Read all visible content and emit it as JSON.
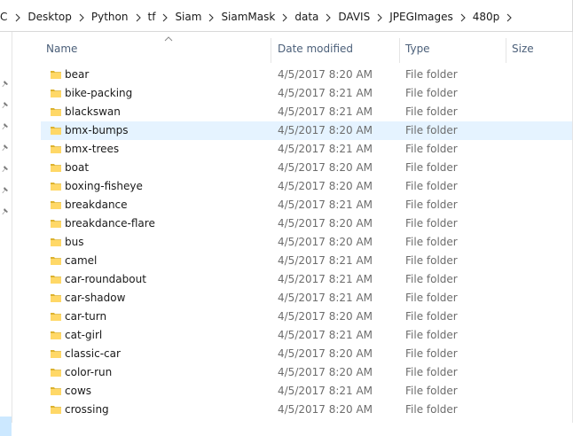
{
  "breadcrumb": {
    "items": [
      "C",
      "Desktop",
      "Python",
      "tf",
      "Siam",
      "SiamMask",
      "data",
      "DAVIS",
      "JPEGImages",
      "480p"
    ]
  },
  "columns": {
    "name": "Name",
    "date_modified": "Date modified",
    "type": "Type",
    "size": "Size"
  },
  "sort": {
    "column": "name",
    "direction": "ascending"
  },
  "colors": {
    "selected_row": "#e5f3ff",
    "folder": "#ffd867",
    "nav_selected": "#cce8ff"
  },
  "files": [
    {
      "name": "bear",
      "date": "4/5/2017 8:20 AM",
      "type": "File folder",
      "selected": false
    },
    {
      "name": "bike-packing",
      "date": "4/5/2017 8:21 AM",
      "type": "File folder",
      "selected": false
    },
    {
      "name": "blackswan",
      "date": "4/5/2017 8:21 AM",
      "type": "File folder",
      "selected": false
    },
    {
      "name": "bmx-bumps",
      "date": "4/5/2017 8:20 AM",
      "type": "File folder",
      "selected": true
    },
    {
      "name": "bmx-trees",
      "date": "4/5/2017 8:21 AM",
      "type": "File folder",
      "selected": false
    },
    {
      "name": "boat",
      "date": "4/5/2017 8:20 AM",
      "type": "File folder",
      "selected": false
    },
    {
      "name": "boxing-fisheye",
      "date": "4/5/2017 8:20 AM",
      "type": "File folder",
      "selected": false
    },
    {
      "name": "breakdance",
      "date": "4/5/2017 8:21 AM",
      "type": "File folder",
      "selected": false
    },
    {
      "name": "breakdance-flare",
      "date": "4/5/2017 8:20 AM",
      "type": "File folder",
      "selected": false
    },
    {
      "name": "bus",
      "date": "4/5/2017 8:20 AM",
      "type": "File folder",
      "selected": false
    },
    {
      "name": "camel",
      "date": "4/5/2017 8:21 AM",
      "type": "File folder",
      "selected": false
    },
    {
      "name": "car-roundabout",
      "date": "4/5/2017 8:21 AM",
      "type": "File folder",
      "selected": false
    },
    {
      "name": "car-shadow",
      "date": "4/5/2017 8:21 AM",
      "type": "File folder",
      "selected": false
    },
    {
      "name": "car-turn",
      "date": "4/5/2017 8:20 AM",
      "type": "File folder",
      "selected": false
    },
    {
      "name": "cat-girl",
      "date": "4/5/2017 8:21 AM",
      "type": "File folder",
      "selected": false
    },
    {
      "name": "classic-car",
      "date": "4/5/2017 8:20 AM",
      "type": "File folder",
      "selected": false
    },
    {
      "name": "color-run",
      "date": "4/5/2017 8:20 AM",
      "type": "File folder",
      "selected": false
    },
    {
      "name": "cows",
      "date": "4/5/2017 8:21 AM",
      "type": "File folder",
      "selected": false
    },
    {
      "name": "crossing",
      "date": "4/5/2017 8:20 AM",
      "type": "File folder",
      "selected": false
    }
  ]
}
